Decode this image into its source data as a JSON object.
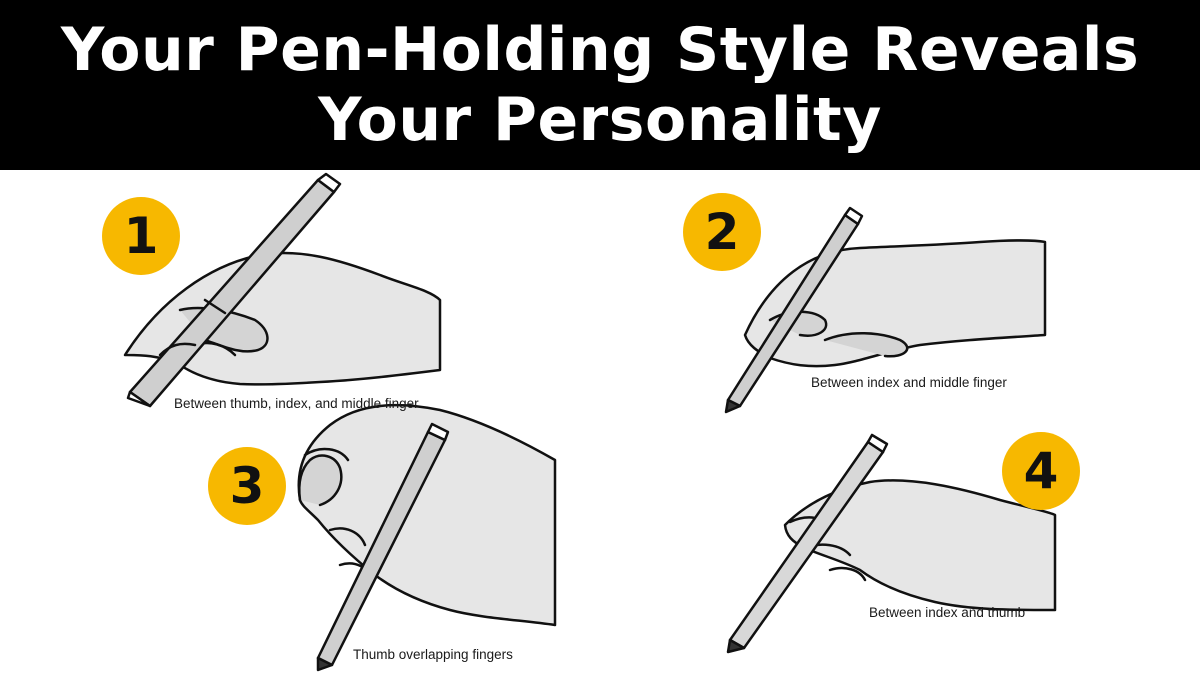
{
  "banner": {
    "title_line1": "Your Pen-Holding Style Reveals",
    "title_line2": "Your Personality"
  },
  "grips": [
    {
      "number": "1",
      "caption": "Between thumb, index, and middle finger"
    },
    {
      "number": "2",
      "caption": "Between index and middle finger"
    },
    {
      "number": "3",
      "caption": "Thumb overlapping fingers"
    },
    {
      "number": "4",
      "caption": "Between index and thumb"
    }
  ],
  "colors": {
    "banner_bg": "#000000",
    "title_text": "#ffffff",
    "badge": "#f7b800",
    "hand_fill": "#e6e6e6",
    "outline": "#111111"
  }
}
